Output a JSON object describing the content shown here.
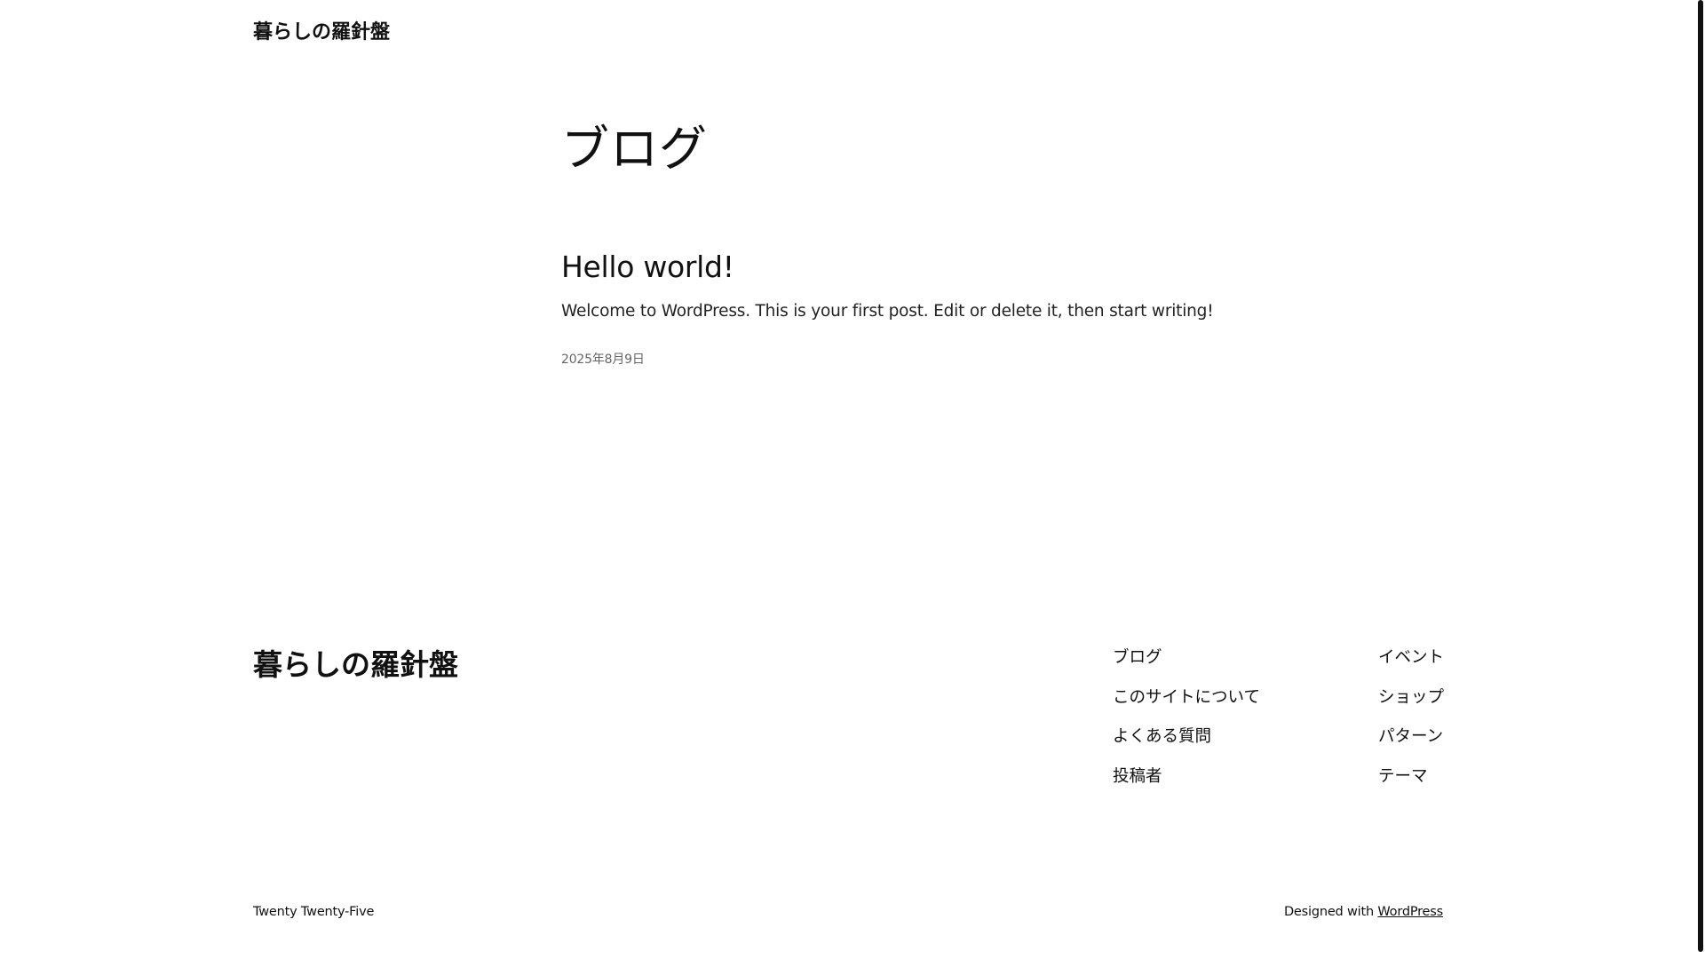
{
  "header": {
    "site_title": "暮らしの羅針盤"
  },
  "main": {
    "page_title": "ブログ",
    "posts": [
      {
        "title": "Hello world!",
        "excerpt": "Welcome to WordPress. This is your first post. Edit or delete it, then start writing!",
        "date": "2025年8月9日"
      }
    ]
  },
  "footer": {
    "site_title": "暮らしの羅針盤",
    "nav_col1": [
      "ブログ",
      "このサイトについて",
      "よくある質問",
      "投稿者"
    ],
    "nav_col2": [
      "イベント",
      "ショップ",
      "パターン",
      "テーマ"
    ],
    "theme_name": "Twenty Twenty-Five",
    "designed_with": "Designed with",
    "wordpress_link": "WordPress"
  }
}
